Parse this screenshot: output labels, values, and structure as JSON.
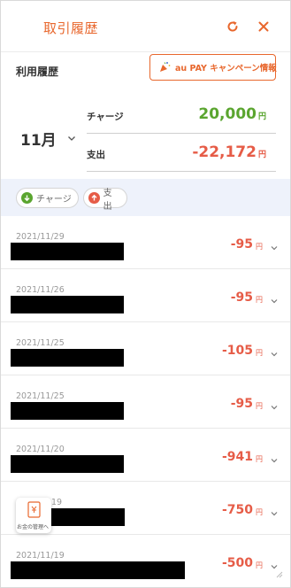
{
  "header": {
    "title": "取引履歴",
    "refresh_icon": "refresh-icon",
    "close_icon": "close-icon"
  },
  "usage": {
    "label": "利用履歴",
    "campaign_button": "au PAY キャンペーン情報"
  },
  "summary": {
    "month": "11月",
    "charge_label": "チャージ",
    "charge_value": "20,000",
    "charge_unit": "円",
    "spend_label": "支出",
    "spend_value": "-22,172",
    "spend_unit": "円"
  },
  "filters": [
    {
      "label": "チャージ",
      "icon": "arrow-down-icon",
      "color": "#5aa52f"
    },
    {
      "label": "支出",
      "icon": "arrow-up-icon",
      "color": "#e65c47"
    }
  ],
  "transactions": [
    {
      "date": "2021/11/29",
      "amount": "-95",
      "unit": "円"
    },
    {
      "date": "2021/11/26",
      "amount": "-95",
      "unit": "円"
    },
    {
      "date": "2021/11/25",
      "amount": "-105",
      "unit": "円"
    },
    {
      "date": "2021/11/25",
      "amount": "-95",
      "unit": "円"
    },
    {
      "date": "2021/11/20",
      "amount": "-941",
      "unit": "円"
    },
    {
      "date": "19",
      "amount": "-750",
      "unit": "円"
    },
    {
      "date": "2021/11/19",
      "amount": "-500",
      "unit": "円"
    }
  ],
  "floating": {
    "label": "お金の管理へ"
  },
  "colors": {
    "accent": "#e8672d",
    "charge": "#5aa52f",
    "spend": "#e65c47"
  }
}
